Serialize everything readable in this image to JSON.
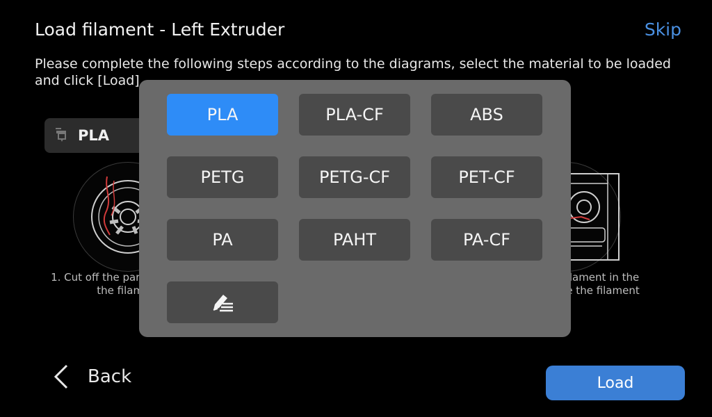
{
  "header": {
    "title": "Load filament - Left Extruder",
    "skip_label": "Skip"
  },
  "instructions": "Please complete the following steps according to the diagrams, select the material to be loaded and click [Load]",
  "current_material": {
    "label": "PLA",
    "icon": "extruder-icon"
  },
  "steps": {
    "left_text": "1. Cut off the part at the front the filament",
    "right_text": "the filament in the figure the filament box."
  },
  "footer": {
    "back_label": "Back",
    "load_label": "Load"
  },
  "material_picker": {
    "selected": "PLA",
    "options": [
      "PLA",
      "PLA-CF",
      "ABS",
      "PETG",
      "PETG-CF",
      "PET-CF",
      "PA",
      "PAHT",
      "PA-CF"
    ],
    "custom_icon": "edit-list-icon"
  },
  "colors": {
    "accent": "#2e8cf7",
    "load_button": "#3b7fd5",
    "skip_link": "#4a90e2",
    "popup_bg": "#6a6a6a",
    "option_bg": "#4a4a4a",
    "spool_accent": "#d23b3b"
  }
}
